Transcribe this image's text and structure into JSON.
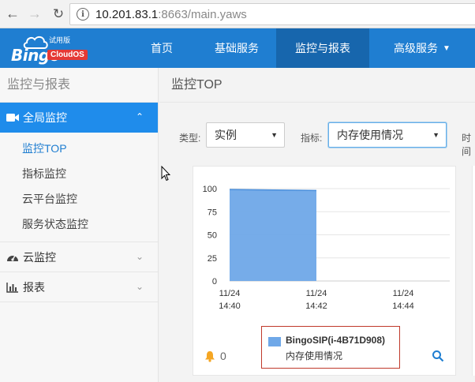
{
  "browser": {
    "url_host": "10.201.83.1",
    "url_rest": ":8663/main.yaws"
  },
  "logo": {
    "trial": "试用版",
    "brand": "Bingo",
    "product": "CloudOS"
  },
  "topnav": {
    "items": [
      {
        "label": "首页"
      },
      {
        "label": "基础服务"
      },
      {
        "label": "监控与报表"
      },
      {
        "label": "高级服务"
      }
    ]
  },
  "sidebar": {
    "title": "监控与报表",
    "groups": [
      {
        "label": "全局监控",
        "subitems": [
          "监控TOP",
          "指标监控",
          "云平台监控",
          "服务状态监控"
        ]
      },
      {
        "label": "云监控"
      },
      {
        "label": "报表"
      }
    ]
  },
  "main": {
    "title": "监控TOP",
    "filters": {
      "type_label": "类型:",
      "type_value": "实例",
      "metric_label": "指标:",
      "metric_value": "内存使用情况",
      "time_label": "时间"
    },
    "alarm_count": "0"
  },
  "colors": {
    "primary": "#1f7ed1",
    "active_nav": "#1766ad",
    "sidebar_active": "#1f8ceb",
    "bar": "#6fa8e8",
    "legend_border": "#c0392b",
    "alarm": "#f5a623"
  },
  "chart_data": {
    "type": "area",
    "title": "",
    "x_ticks": [
      [
        "11/24",
        "14:40"
      ],
      [
        "11/24",
        "14:42"
      ],
      [
        "11/24",
        "14:44"
      ]
    ],
    "y_ticks": [
      "0",
      "25",
      "50",
      "75",
      "100"
    ],
    "ylim": [
      0,
      100
    ],
    "series": [
      {
        "name": "BingoSIP(i-4B71D908) 内存使用情况",
        "x": [
          "14:40",
          "14:42"
        ],
        "values": [
          99,
          98
        ]
      }
    ],
    "legend": [
      "BingoSIP(i-4B71D908)",
      "内存使用情况"
    ]
  }
}
